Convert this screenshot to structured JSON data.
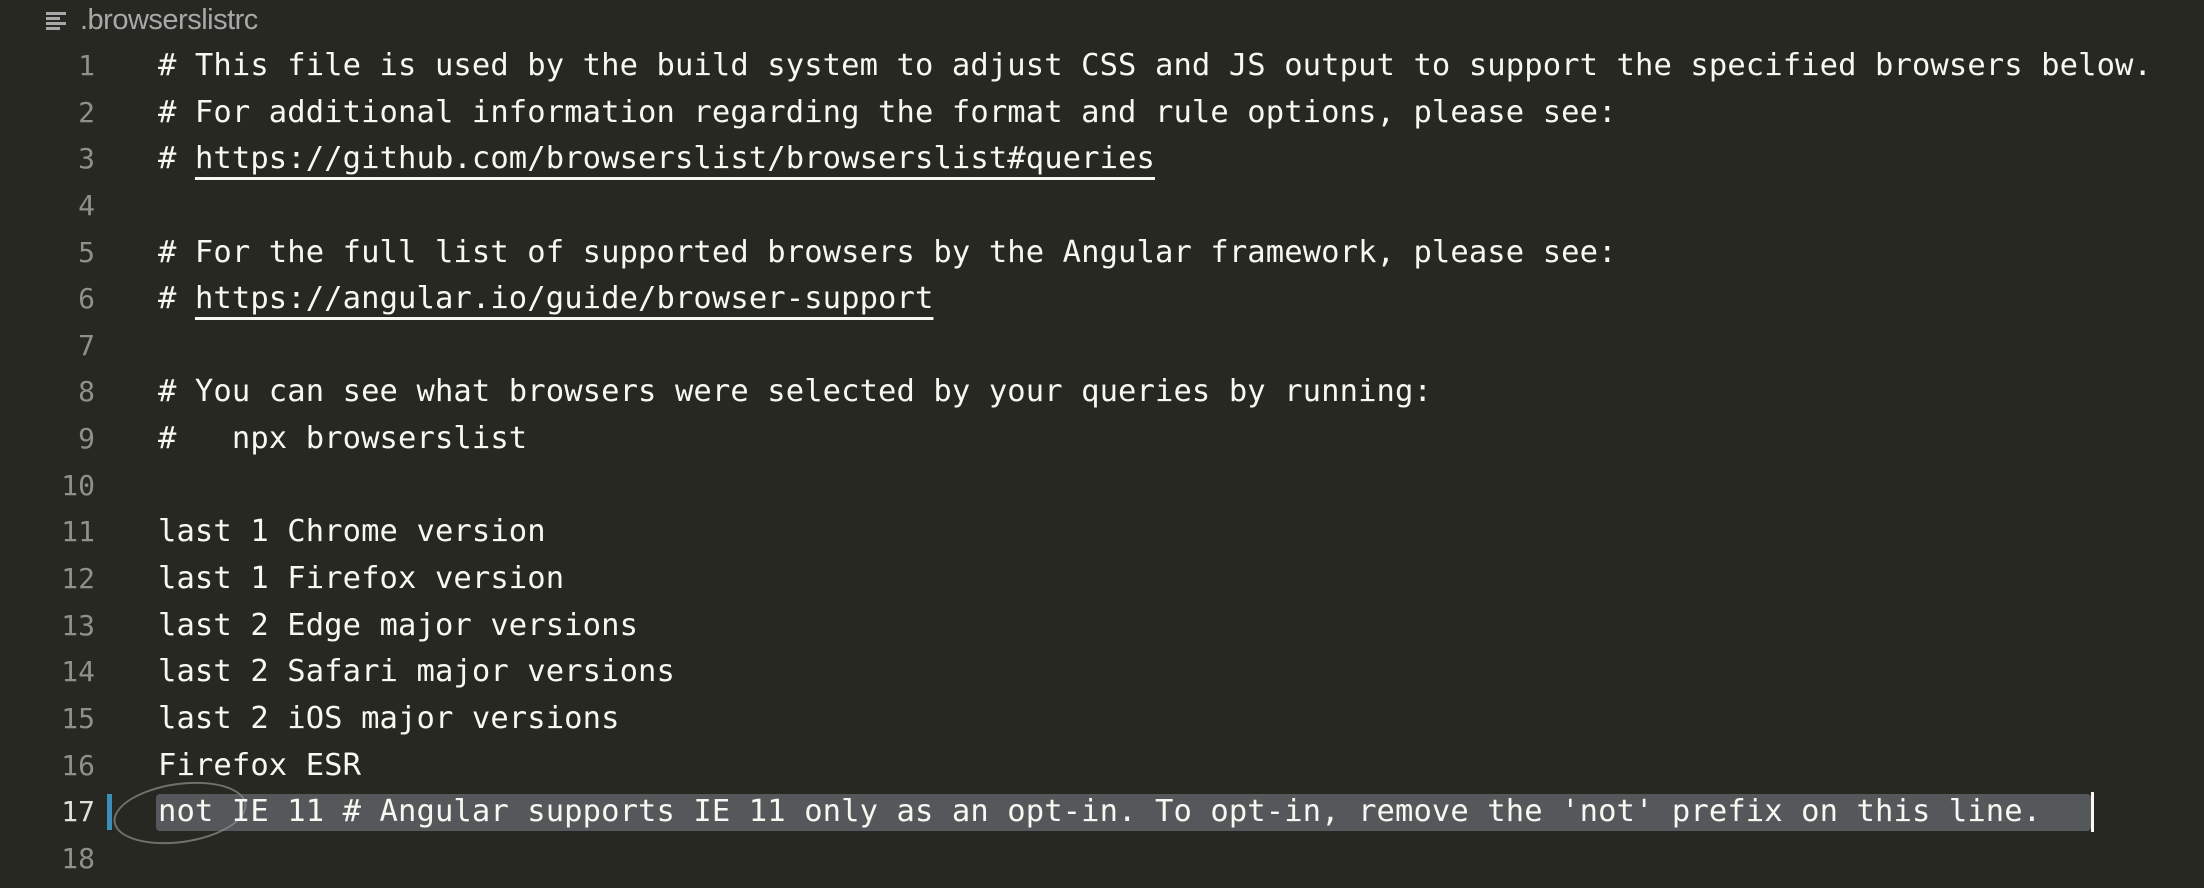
{
  "breadcrumb": {
    "icon": "file-lines-icon",
    "filename": ".browserslistrc"
  },
  "editor": {
    "active_line": 17,
    "lines": [
      {
        "number": "1",
        "text": "# This file is used by the build system to adjust CSS and JS output to support the specified browsers below.",
        "link": ""
      },
      {
        "number": "2",
        "text": "# For additional information regarding the format and rule options, please see:",
        "link": ""
      },
      {
        "number": "3",
        "text": "# ",
        "link": "https://github.com/browserslist/browserslist#queries"
      },
      {
        "number": "4",
        "text": "",
        "link": ""
      },
      {
        "number": "5",
        "text": "# For the full list of supported browsers by the Angular framework, please see:",
        "link": ""
      },
      {
        "number": "6",
        "text": "# ",
        "link": "https://angular.io/guide/browser-support"
      },
      {
        "number": "7",
        "text": "",
        "link": ""
      },
      {
        "number": "8",
        "text": "# You can see what browsers were selected by your queries by running:",
        "link": ""
      },
      {
        "number": "9",
        "text": "#   npx browserslist",
        "link": ""
      },
      {
        "number": "10",
        "text": "",
        "link": ""
      },
      {
        "number": "11",
        "text": "last 1 Chrome version",
        "link": ""
      },
      {
        "number": "12",
        "text": "last 1 Firefox version",
        "link": ""
      },
      {
        "number": "13",
        "text": "last 2 Edge major versions",
        "link": ""
      },
      {
        "number": "14",
        "text": "last 2 Safari major versions",
        "link": ""
      },
      {
        "number": "15",
        "text": "last 2 iOS major versions",
        "link": ""
      },
      {
        "number": "16",
        "text": "Firefox ESR",
        "link": ""
      },
      {
        "number": "17",
        "text": "not IE 11 # Angular supports IE 11 only as an opt-in. To opt-in, remove the 'not' prefix on this line.",
        "link": ""
      },
      {
        "number": "18",
        "text": "",
        "link": ""
      }
    ]
  },
  "colors": {
    "background": "#272822",
    "text": "#f8f8f2",
    "line_number": "#90908a",
    "selection": "#55585a",
    "gutter_marker": "#3b8eb8"
  }
}
